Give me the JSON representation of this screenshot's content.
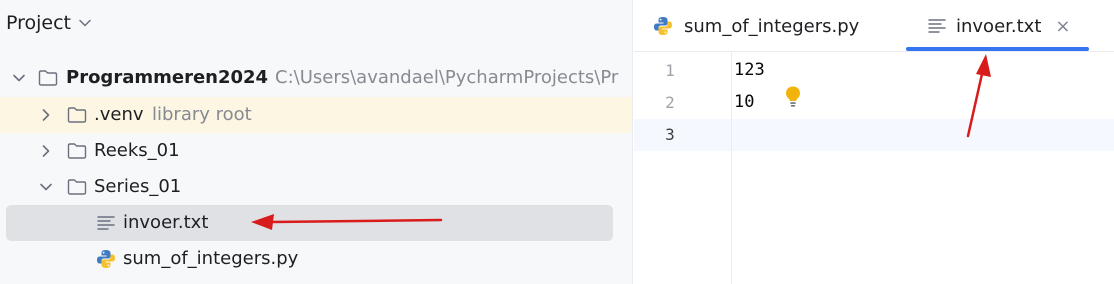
{
  "project_panel": {
    "title": "Project",
    "tree": [
      {
        "label": "Programmeren2024",
        "path": "C:\\Users\\avandael\\PycharmProjects\\Pr",
        "expanded": true,
        "icon": "folder-icon"
      },
      {
        "label": ".venv",
        "hint": "library root",
        "expanded": false,
        "icon": "folder-icon"
      },
      {
        "label": "Reeks_01",
        "expanded": false,
        "icon": "folder-icon"
      },
      {
        "label": "Series_01",
        "expanded": true,
        "icon": "folder-icon"
      },
      {
        "label": "invoer.txt",
        "icon": "text-file-icon",
        "selected": true
      },
      {
        "label": "sum_of_integers.py",
        "icon": "python-file-icon"
      }
    ]
  },
  "editor": {
    "tabs": [
      {
        "label": "sum_of_integers.py",
        "icon": "python-file-icon",
        "active": false
      },
      {
        "label": "invoer.txt",
        "icon": "text-file-icon",
        "active": true,
        "close": "×"
      }
    ],
    "lines": [
      {
        "number": "1",
        "text": "123"
      },
      {
        "number": "2",
        "text": "10"
      },
      {
        "number": "3",
        "text": ""
      }
    ],
    "current_line": 3
  },
  "colors": {
    "accent": "#3574f0",
    "selection": "#dfe1e5",
    "library_row": "#fcf6e3",
    "annotation_arrow": "#d81b1b",
    "intention_bulb": "#f2b40c"
  }
}
